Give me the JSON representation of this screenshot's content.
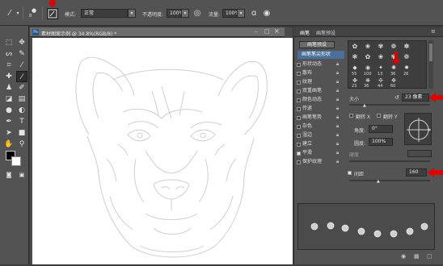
{
  "options_bar": {
    "mode_label": "模式:",
    "mode_value": "正常",
    "opacity_label": "不透明度:",
    "opacity_value": "100%",
    "flow_label": "流量:",
    "flow_value": "100%",
    "brush_size": "8"
  },
  "document": {
    "tab_title": "素材图案示例 @ 34.8%(RGB/8) *",
    "tab_icon": "Ps"
  },
  "brush_panel": {
    "tabs": [
      "画笔",
      "画笔预设"
    ],
    "preset_button": "画笔预设",
    "list": [
      {
        "label": "画笔笔尖形状",
        "checked": false,
        "selected": true
      },
      {
        "label": "形状动态",
        "checked": false
      },
      {
        "label": "散布",
        "checked": false
      },
      {
        "label": "纹理",
        "checked": false
      },
      {
        "label": "双重画笔",
        "checked": false
      },
      {
        "label": "颜色动态",
        "checked": false
      },
      {
        "label": "传递",
        "checked": false
      },
      {
        "label": "画笔笔势",
        "checked": false
      },
      {
        "label": "杂色",
        "checked": false
      },
      {
        "label": "湿边",
        "checked": false
      },
      {
        "label": "建立",
        "checked": false
      },
      {
        "label": "平滑",
        "checked": true
      },
      {
        "label": "保护纹理",
        "checked": false
      }
    ],
    "brush_numbers_row1": [
      "55",
      "100",
      "13",
      "36",
      "26"
    ],
    "brush_numbers_row2": [
      "23",
      "36",
      "44",
      "60"
    ],
    "size_label": "大小",
    "size_value": "23 像素",
    "flip_x": "翻转 X",
    "flip_y": "翻转 Y",
    "angle_label": "角度:",
    "angle_value": "0°",
    "roundness_label": "圆度:",
    "roundness_value": "100%",
    "hardness_label": "硬度",
    "spacing_label": "间距",
    "spacing_value": "160"
  },
  "colors": {
    "ui_dark": "#535353",
    "highlight": "#e10000",
    "selected_item": "#4a6f9a"
  }
}
